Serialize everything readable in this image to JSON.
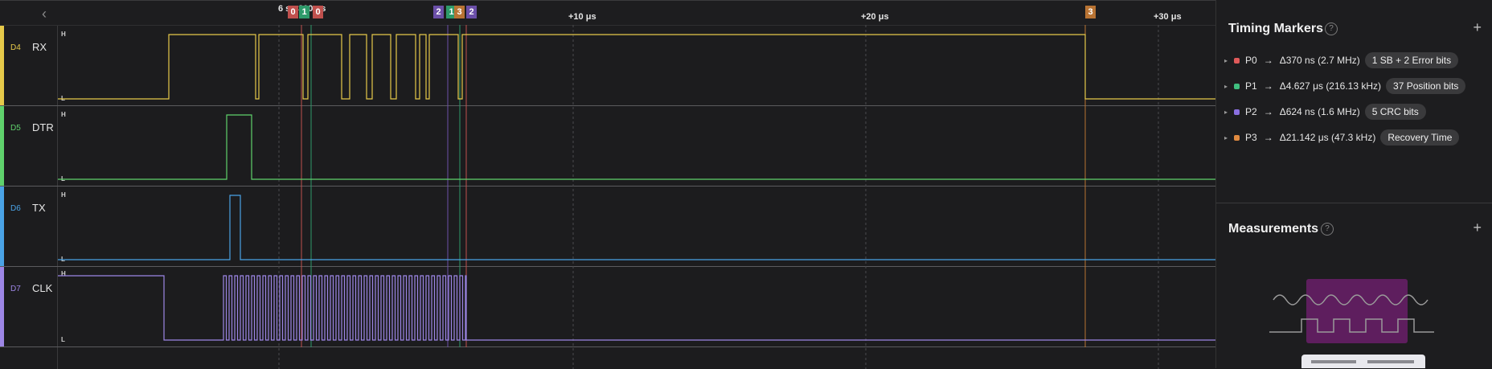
{
  "ruler": {
    "back_icon": "chevron-left-icon",
    "ticks": [
      "+10 μs",
      "+20 μs",
      "+30 μs"
    ],
    "cursor_label": "6 s : 300 μs",
    "marker_tags": [
      {
        "label": "0",
        "color": "#c0504d"
      },
      {
        "label": "1",
        "color": "#2e9a6a"
      },
      {
        "label": "0",
        "color": "#c0504d"
      },
      {
        "label": "2",
        "color": "#6b4fa8"
      },
      {
        "label": "1",
        "color": "#2e9a6a"
      },
      {
        "label": "3",
        "color": "#b87333"
      },
      {
        "label": "2",
        "color": "#6b4fa8"
      },
      {
        "label": "3",
        "color": "#b87333"
      }
    ]
  },
  "channels": [
    {
      "id": "D4",
      "name": "RX",
      "color": "#e6c94a",
      "high": "H",
      "low": "L"
    },
    {
      "id": "D5",
      "name": "DTR",
      "color": "#5fd16c",
      "high": "H",
      "low": "L"
    },
    {
      "id": "D6",
      "name": "TX",
      "color": "#4aa3e6",
      "high": "H",
      "low": "L"
    },
    {
      "id": "D7",
      "name": "CLK",
      "color": "#9d86e6",
      "high": "H",
      "low": "L"
    }
  ],
  "timing_markers": {
    "title": "Timing Markers",
    "help_icon": "question-circle-icon",
    "add_icon": "plus-icon",
    "items": [
      {
        "name": "P0",
        "color": "#e05a5a",
        "delta": "Δ370 ns (2.7 MHz)",
        "label": "1 SB + 2 Error bits"
      },
      {
        "name": "P1",
        "color": "#3fbf7f",
        "delta": "Δ4.627 μs (216.13 kHz)",
        "label": "37 Position bits"
      },
      {
        "name": "P2",
        "color": "#8a6fe0",
        "delta": "Δ624 ns (1.6 MHz)",
        "label": "5 CRC bits"
      },
      {
        "name": "P3",
        "color": "#e08a40",
        "delta": "Δ21.142 μs (47.3 kHz)",
        "label": "Recovery Time"
      }
    ]
  },
  "measurements": {
    "title": "Measurements",
    "help_icon": "question-circle-icon",
    "add_icon": "plus-icon",
    "illustration": "measurement-illustration"
  }
}
